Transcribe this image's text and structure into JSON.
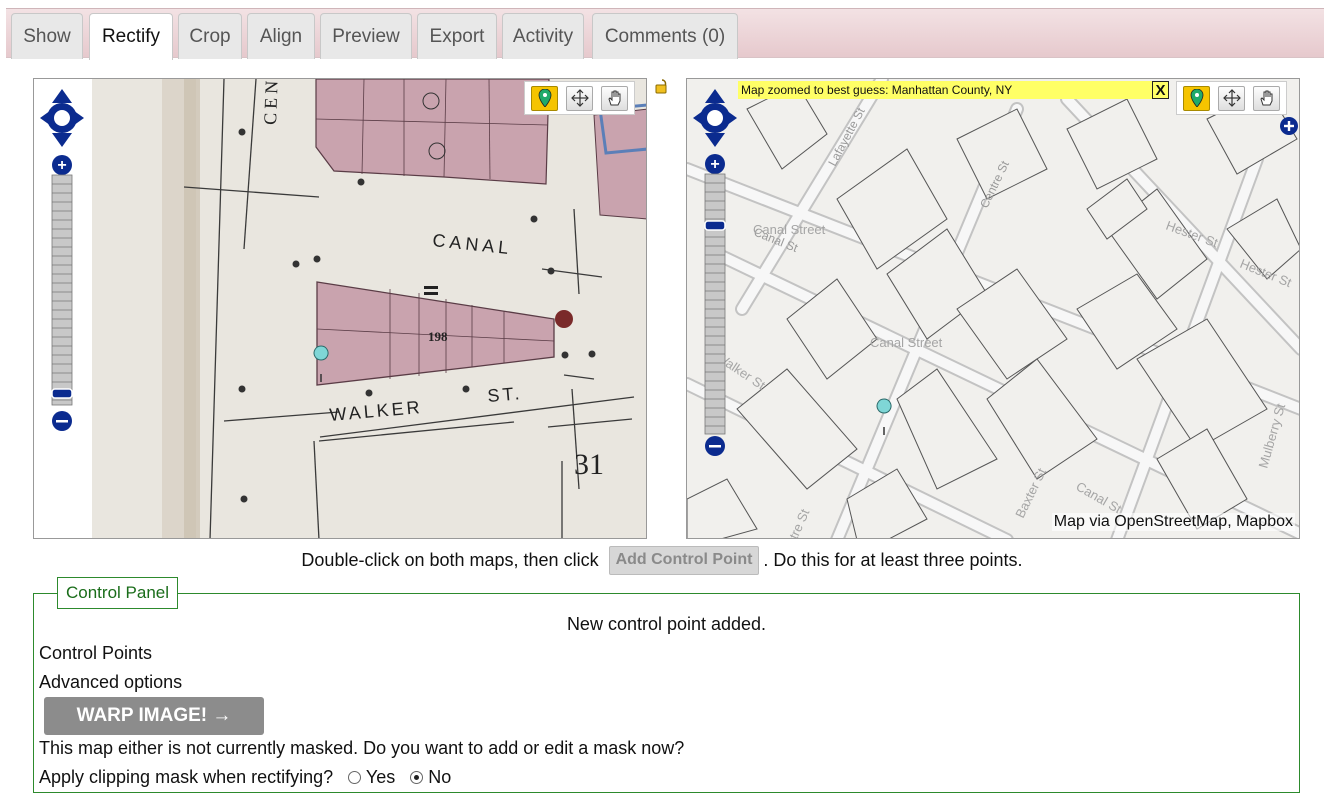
{
  "tabs": [
    {
      "label": "Show",
      "active": false
    },
    {
      "label": "Rectify",
      "active": true
    },
    {
      "label": "Crop",
      "active": false
    },
    {
      "label": "Align",
      "active": false
    },
    {
      "label": "Preview",
      "active": false
    },
    {
      "label": "Export",
      "active": false
    },
    {
      "label": "Activity",
      "active": false
    },
    {
      "label": "Comments (0)",
      "active": false
    }
  ],
  "left_map": {
    "labels": {
      "street_top": "CEN",
      "canal": "CANAL",
      "walker": "WALKER",
      "st": "ST.",
      "block_number": "198",
      "sheet_number": "31"
    },
    "tools": [
      "place-marker-icon",
      "move-icon",
      "pan-hand-icon"
    ],
    "lock_icon": "lock-icon"
  },
  "right_map": {
    "notice": "Map zoomed to best guess: Manhattan County, NY",
    "notice_close": "X",
    "attribution": "Map via OpenStreetMap, Mapbox",
    "street_labels": {
      "lafayette": "Lafayette St",
      "centre": "Centre St",
      "canal_1": "Canal Street",
      "canal_2": "Canal Street",
      "canal_3": "Canal St",
      "hester_1": "Hester St",
      "hester_2": "Hester St",
      "walker": "Walker St",
      "baxter": "Baxter St",
      "mulberry": "Mulberry St",
      "st_left": "Canal St",
      "st_bottom": "tre St"
    },
    "tools": [
      "place-marker-icon",
      "move-icon",
      "pan-hand-icon"
    ]
  },
  "instruction": {
    "before": "Double-click on both maps, then click",
    "button": "Add Control Point",
    "after": ". Do this for at least three points."
  },
  "control_panel": {
    "legend": "Control Panel",
    "status": "New control point added.",
    "control_points": "Control Points",
    "advanced": "Advanced options",
    "warp_button": "WARP IMAGE! →",
    "mask_text": "This map either is not currently masked. Do you want to add or edit a mask now?",
    "clip_question": "Apply clipping mask when rectifying?",
    "clip_yes": "Yes",
    "clip_no": "No",
    "clip_selected": "No"
  },
  "colors": {
    "accent_green": "#2d8a2d",
    "tab_strip": "#e6c9cd",
    "building_pink": "#c9a3ae",
    "zoom_blue": "#0b2b8f",
    "notice_yellow": "#ffff66"
  }
}
